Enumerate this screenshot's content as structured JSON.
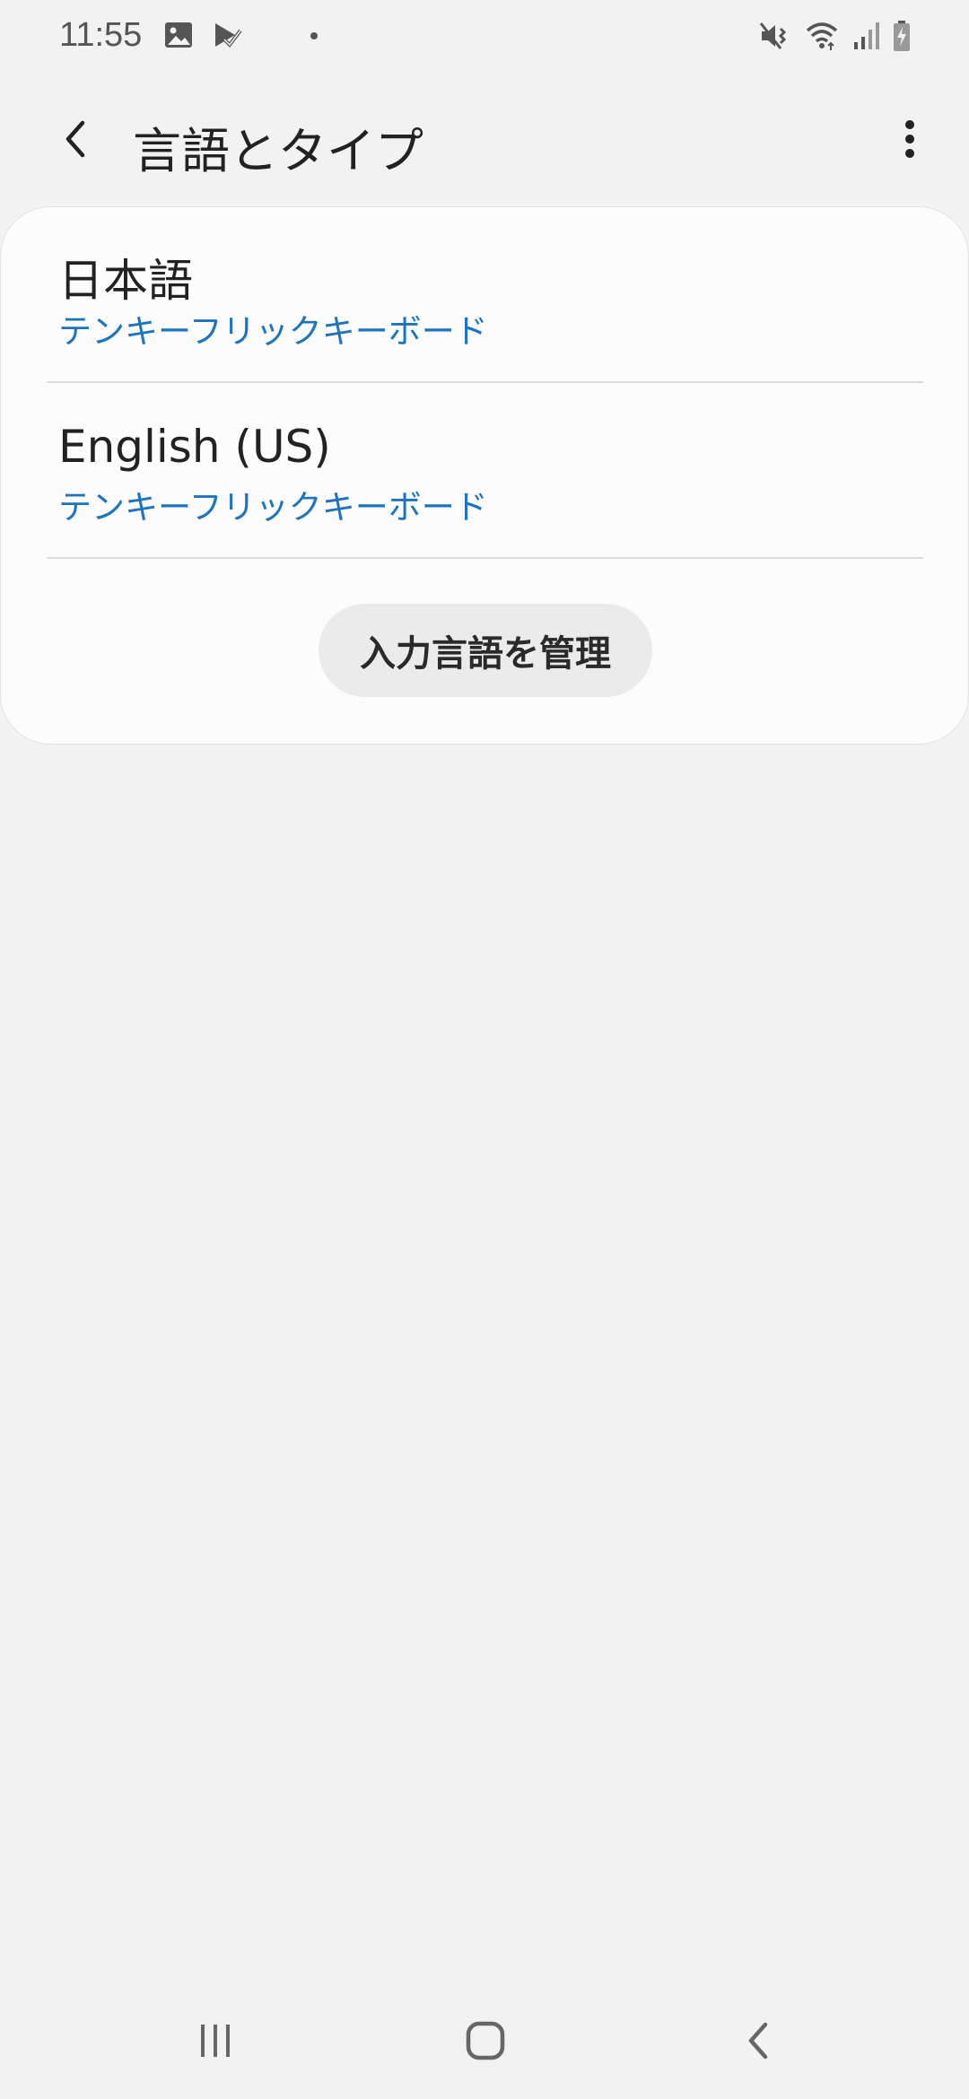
{
  "status_bar": {
    "time": "11:55",
    "left_icons": [
      "gallery-icon",
      "play-store-icon"
    ],
    "right_icons": [
      "mute-vibrate-icon",
      "wifi-icon",
      "signal-icon",
      "battery-charging-icon"
    ]
  },
  "app_bar": {
    "title": "言語とタイプ",
    "back_icon": "back-arrow-icon",
    "more_icon": "more-vertical-icon"
  },
  "languages": [
    {
      "name": "日本語",
      "keyboard": "テンキーフリックキーボード"
    },
    {
      "name": "English (US)",
      "keyboard": "テンキーフリックキーボード"
    }
  ],
  "manage_button": {
    "label": "入力言語を管理"
  },
  "nav_bar": {
    "buttons": [
      "recent-apps-icon",
      "home-icon",
      "back-icon"
    ]
  },
  "colors": {
    "background": "#f2f2f2",
    "card": "#fcfcfc",
    "accent": "#1e73be",
    "button_bg": "#ebebeb"
  }
}
